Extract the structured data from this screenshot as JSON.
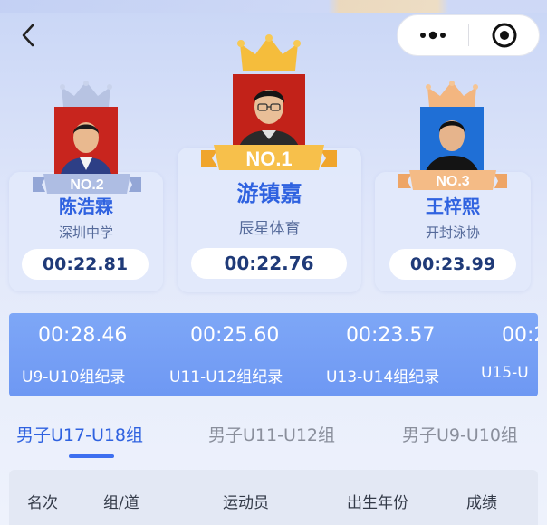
{
  "nav": {
    "back_icon": "chevron-left-icon",
    "more_icon": "more-dots-icon",
    "close_icon": "target-close-icon"
  },
  "podium": [
    {
      "rank": "NO.2",
      "name": "陈浩霖",
      "club": "深圳中学",
      "time": "00:22.81"
    },
    {
      "rank": "NO.1",
      "name": "游镇嘉",
      "club": "辰星体育",
      "time": "00:22.76"
    },
    {
      "rank": "NO.3",
      "name": "王梓熙",
      "club": "开封泳协",
      "time": "00:23.99"
    }
  ],
  "records": [
    {
      "time": "00:28.46",
      "label": "U9-U10组纪录"
    },
    {
      "time": "00:25.60",
      "label": "U11-U12组纪录"
    },
    {
      "time": "00:23.57",
      "label": "U13-U14组纪录"
    },
    {
      "time": "00:2",
      "label": "U15-U"
    }
  ],
  "tabs": [
    {
      "label": "男子U17-U18组",
      "active": true
    },
    {
      "label": "男子U11-U12组",
      "active": false
    },
    {
      "label": "男子U9-U10组",
      "active": false
    }
  ],
  "table": {
    "headers": [
      "名次",
      "组/道",
      "运动员",
      "出生年份",
      "成绩"
    ]
  },
  "colors": {
    "accent": "#2f62e0",
    "gold": "#f5b63a",
    "silver": "#a9b8dc",
    "bronze": "#f2b77e",
    "record_band": "#7ea7f7"
  }
}
